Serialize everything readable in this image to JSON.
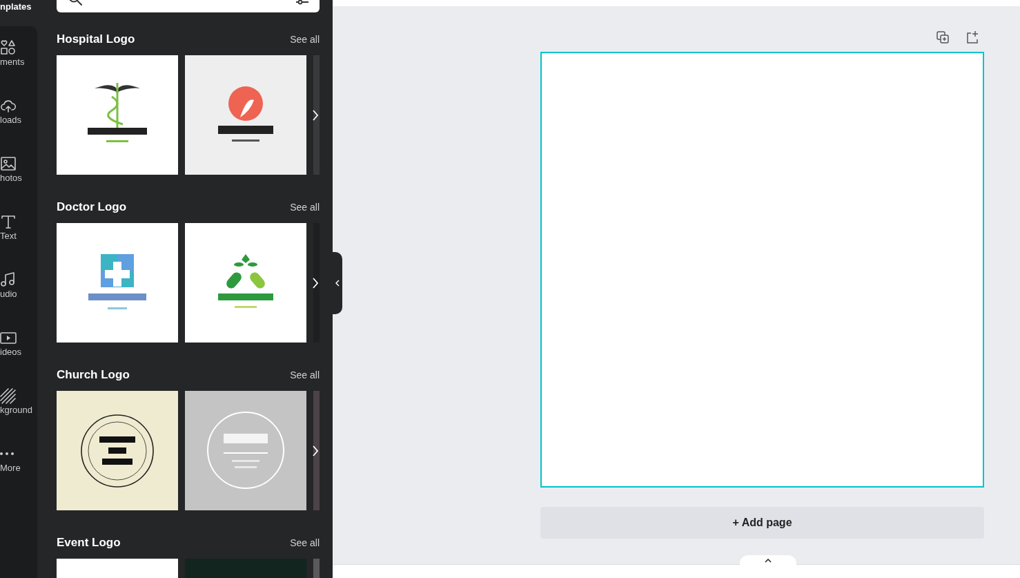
{
  "sidebar": {
    "header": "nplates",
    "items": [
      {
        "label": "ments"
      },
      {
        "label": "loads"
      },
      {
        "label": "hotos"
      },
      {
        "label": "Text"
      },
      {
        "label": "udio"
      },
      {
        "label": "ideos"
      },
      {
        "label": "kground"
      },
      {
        "label": "More"
      }
    ]
  },
  "panel": {
    "sections": [
      {
        "title": "Hospital Logo",
        "see_all": "See all"
      },
      {
        "title": "Doctor Logo",
        "see_all": "See all"
      },
      {
        "title": "Church Logo",
        "see_all": "See all"
      },
      {
        "title": "Event Logo",
        "see_all": "See all"
      }
    ]
  },
  "canvas": {
    "add_page": "+ Add page"
  }
}
